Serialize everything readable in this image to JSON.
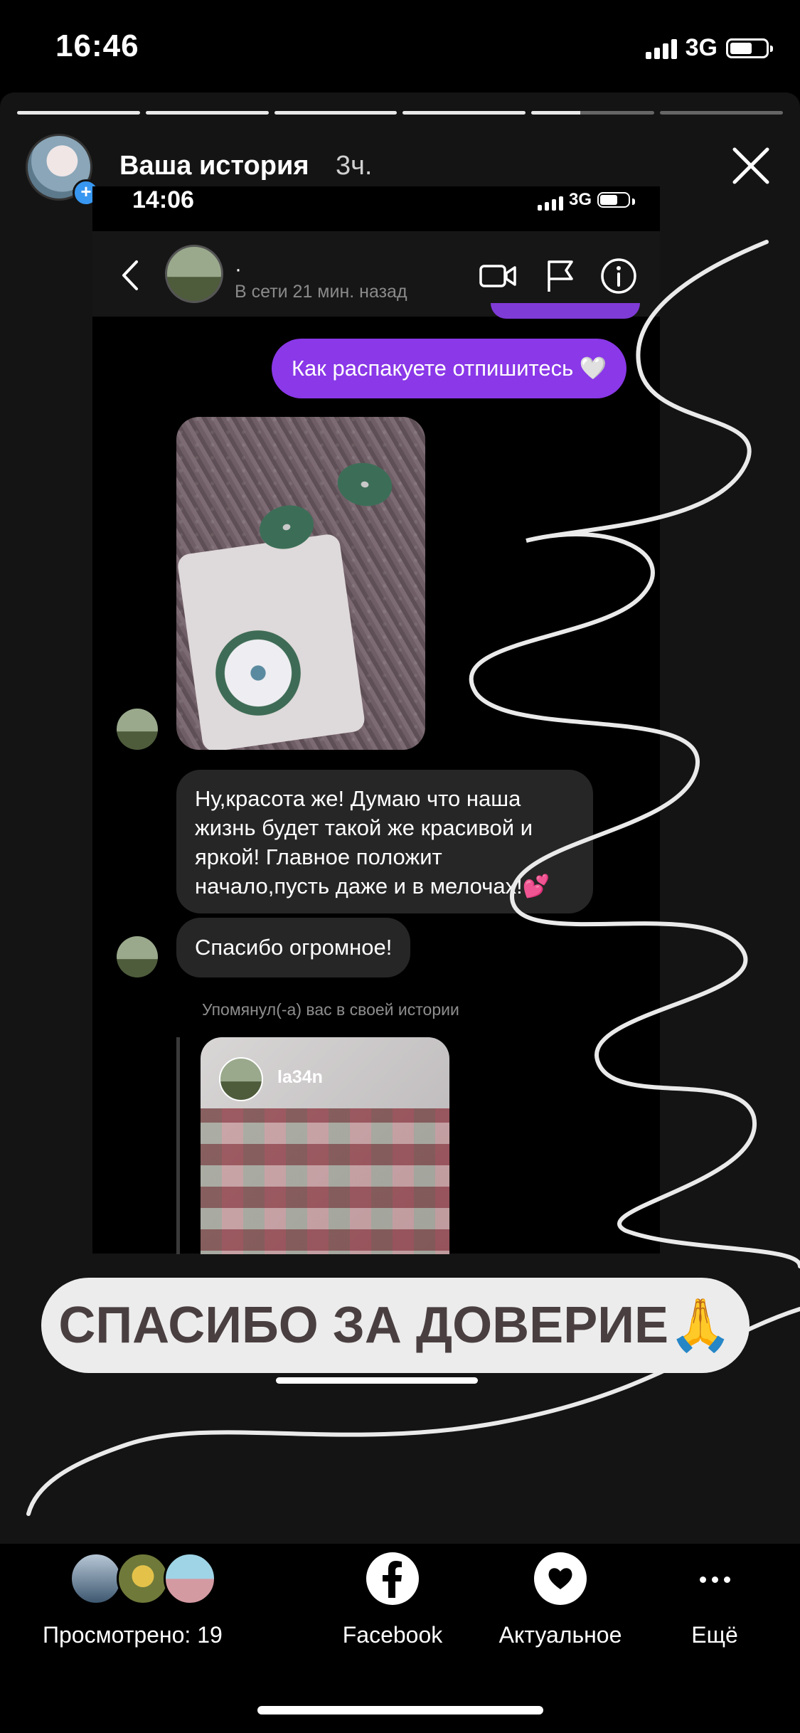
{
  "status_bar": {
    "time": "16:46",
    "network": "3G"
  },
  "story": {
    "progress": [
      1,
      1,
      1,
      1,
      0.4,
      0
    ],
    "title": "Ваша история",
    "age": "3ч."
  },
  "screenshot": {
    "status": {
      "time": "14:06",
      "network": "3G"
    },
    "header": {
      "name": "·",
      "status": "В сети 21 мин. назад"
    },
    "messages": {
      "outgoing": "Как распакуете отпишитесь 🤍",
      "incoming_1": "Ну,красота же! Думаю что наша жизнь будет такой же красивой и яркой! Главное положит начало,пусть даже и в мелочах!💕",
      "incoming_2": "Спасибо огромное!",
      "mention": "Упомянул(-а) вас в своей истории",
      "story_user": "la34n"
    }
  },
  "caption": "СПАСИБО ЗА ДОВЕРИЕ🙏",
  "bottom_bar": {
    "viewed": "Просмотрено: 19",
    "facebook": "Facebook",
    "highlights": "Актуальное",
    "more": "Ещё"
  },
  "colors": {
    "accent_purple": "#8a38e8",
    "bubble_gray": "#262626",
    "caption_bg": "#ececec"
  }
}
